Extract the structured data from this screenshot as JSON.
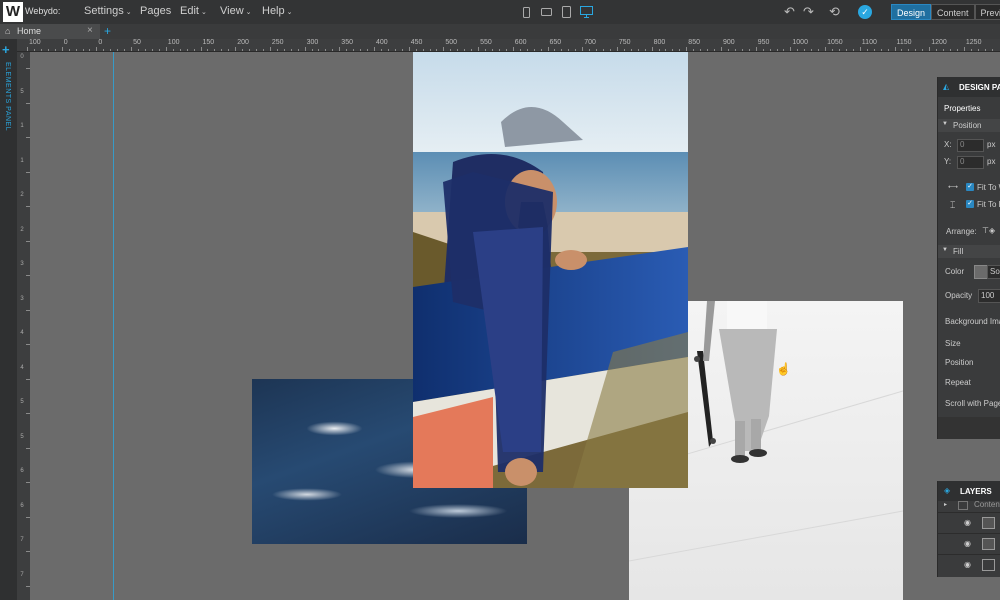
{
  "app": {
    "brand": "Webydo:",
    "logo_letter": "W"
  },
  "menu": [
    {
      "label": "Settings",
      "caret": true
    },
    {
      "label": "Pages",
      "caret": false
    },
    {
      "label": "Edit",
      "caret": true
    },
    {
      "label": "View",
      "caret": true
    },
    {
      "label": "Help",
      "caret": true
    }
  ],
  "devices": [
    "mobile-portrait-icon",
    "mobile-landscape-icon",
    "tablet-icon",
    "desktop-icon"
  ],
  "toolbar": {
    "undo": "↶",
    "redo": "↷",
    "history": "⟲",
    "publish": "✓"
  },
  "mode_tabs": [
    {
      "label": "Design",
      "active": true
    },
    {
      "label": "Content",
      "active": false
    },
    {
      "label": "Preview",
      "active": false
    }
  ],
  "tabs": {
    "home": "Home",
    "close": "×",
    "add": "+"
  },
  "ruler_h": [
    "100",
    "0",
    "0",
    "50",
    "100",
    "150",
    "200",
    "250",
    "300",
    "350",
    "400",
    "450",
    "500",
    "550",
    "600",
    "650",
    "700",
    "750",
    "800",
    "850",
    "900",
    "950",
    "1000",
    "1050",
    "1100",
    "1150",
    "1200",
    "1250"
  ],
  "ruler_v": [
    "0",
    "5",
    "1",
    "1",
    "2",
    "2",
    "3",
    "3",
    "4",
    "4",
    "5",
    "5",
    "6",
    "6",
    "7",
    "7"
  ],
  "left_panel": {
    "add": "+",
    "label": "ELEMENTS PANEL"
  },
  "design_panel": {
    "title": "DESIGN PANEL",
    "tab": "Properties",
    "position_section": "Position",
    "x_label": "X:",
    "x_value": "0",
    "x_unit": "px",
    "y_label": "Y:",
    "y_value": "0",
    "y_unit": "px",
    "fit_width": "Fit To Width",
    "fit_height": "Fit To Height",
    "arrange": "Arrange:",
    "fill_section": "Fill",
    "color_label": "Color",
    "color_value": "Solid",
    "opacity_label": "Opacity",
    "opacity_value": "100",
    "bg_image": "Background Image",
    "size": "Size",
    "position": "Position",
    "repeat": "Repeat",
    "scroll": "Scroll with Page"
  },
  "layers_panel": {
    "title": "LAYERS",
    "row0": "Content"
  },
  "colors": {
    "accent": "#2aa7e0",
    "canvas": "#6b6b6b",
    "chrome": "#333435"
  }
}
